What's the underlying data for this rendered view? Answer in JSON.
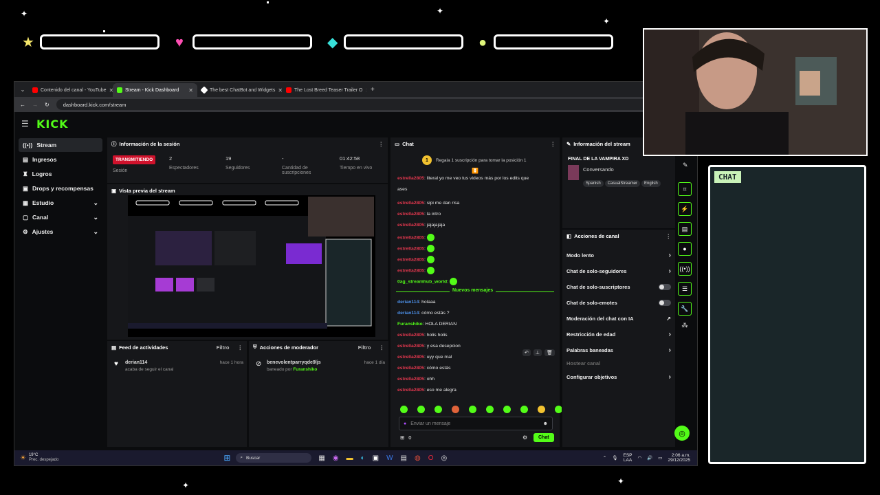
{
  "overlay": {
    "bar_icons": [
      "star-icon",
      "heart-icon",
      "diamond-icon",
      "coin-icon"
    ],
    "chat_box_label": "CHAT"
  },
  "browser": {
    "tabs": [
      {
        "label": "Contenido del canal - YouTube",
        "color": "#ff0000"
      },
      {
        "label": "Stream - Kick Dashboard",
        "color": "#53fc18"
      },
      {
        "label": "The best ChatBot and Widgets",
        "color": "#ffffff"
      },
      {
        "label": "The Lost Breed Teaser Trailer O",
        "color": "#ff0000"
      }
    ],
    "url": "dashboard.kick.com/stream"
  },
  "app": {
    "logo": "KICK",
    "sidebar": [
      {
        "label": "Stream",
        "icon": "stream-icon",
        "active": true
      },
      {
        "label": "Ingresos",
        "icon": "money-icon"
      },
      {
        "label": "Logros",
        "icon": "trophy-icon"
      },
      {
        "label": "Drops y recompensas",
        "icon": "gift-icon"
      },
      {
        "label": "Estudio",
        "icon": "studio-icon",
        "chevron": true
      },
      {
        "label": "Canal",
        "icon": "channel-icon",
        "chevron": true
      },
      {
        "label": "Ajustes",
        "icon": "settings-icon",
        "chevron": true
      }
    ],
    "session": {
      "title": "Información de la sesión",
      "status": "TRANSMITIENDO",
      "status_label": "Sesión",
      "viewers": "2",
      "viewers_label": "Espectadores",
      "followers": "19",
      "followers_label": "Seguidores",
      "subs": "-",
      "subs_label": "Cantidad de suscripciones",
      "time": "01:42:58",
      "time_label": "Tiempo en vivo"
    },
    "preview_title": "Vista previa del stream",
    "activity": {
      "title": "Feed de actividades",
      "filter": "Filtro",
      "user": "derian114",
      "time": "hace 1 hora",
      "text": "acaba de seguir el canal"
    },
    "moderator": {
      "title": "Acciones de moderador",
      "filter": "Filtro",
      "user": "benevolentparryqde9ljs",
      "time": "hace 1 día",
      "text_prefix": "baneado por",
      "by": "Furanshiko"
    },
    "chat": {
      "title": "Chat",
      "promo": "Regala 1 suscripción para tomar la posición 1",
      "promo_number": "1",
      "new_messages": "Nuevos mensajes",
      "placeholder": "Enviar un mensaje",
      "count": "0",
      "send": "Chat",
      "messages": [
        {
          "user": "estrella2805",
          "color": "#e3374e",
          "text": ": literal yo me veo tus videos más por los edits que"
        },
        {
          "user": "",
          "color": "#e6e6e6",
          "text": "ases"
        },
        {
          "user": "estrella2805",
          "color": "#e3374e",
          "text": ": sipi me dan risa"
        },
        {
          "user": "estrella2805",
          "color": "#e3374e",
          "text": ": la intro"
        },
        {
          "user": "estrella2805",
          "color": "#e3374e",
          "text": ": jajajajaja"
        },
        {
          "user": "estrella2805",
          "color": "#e3374e",
          "text": ":",
          "emote": true
        },
        {
          "user": "estrella2805",
          "color": "#e3374e",
          "text": ":",
          "emote": true
        },
        {
          "user": "estrella2805",
          "color": "#e3374e",
          "text": ":",
          "emote": true
        },
        {
          "user": "estrella2805",
          "color": "#e3374e",
          "text": ":",
          "emote": true
        },
        {
          "user": "0ag_streamhub_world",
          "color": "#53fc18",
          "text": ":",
          "emote": true
        },
        {
          "user": "derian114",
          "color": "#4c8fe8",
          "text": ": holaaa"
        },
        {
          "user": "derian114",
          "color": "#4c8fe8",
          "text": ": cómo estás ?"
        },
        {
          "user": "Furanshiko",
          "color": "#53fc18",
          "text": ": HOLA DERIAN"
        },
        {
          "user": "estrella2805",
          "color": "#e3374e",
          "text": ": holis holis"
        },
        {
          "user": "estrella2805",
          "color": "#e3374e",
          "text": ": y esa desepcion"
        },
        {
          "user": "estrella2805",
          "color": "#e3374e",
          "text": ": uyy que mal"
        },
        {
          "user": "estrella2805",
          "color": "#e3374e",
          "text": ": cómo estás"
        },
        {
          "user": "estrella2805",
          "color": "#e3374e",
          "text": ": ohh"
        },
        {
          "user": "estrella2805",
          "color": "#e3374e",
          "text": ": eso me alegra"
        }
      ]
    },
    "stream_info": {
      "title": "Información del stream",
      "stream_title": "FINAL DE LA VAMPIRA XD",
      "category": "Conversando",
      "tags": [
        "Spanish",
        "CasualStreamer",
        "English"
      ]
    },
    "channel_actions": {
      "title": "Acciones de canal",
      "items": [
        {
          "label": "Modo lento",
          "type": "chevron"
        },
        {
          "label": "Chat de solo-seguidores",
          "type": "chevron"
        },
        {
          "label": "Chat de solo-suscriptores",
          "type": "toggle"
        },
        {
          "label": "Chat de solo-emotes",
          "type": "toggle"
        },
        {
          "label": "Moderación del chat con IA",
          "type": "link"
        },
        {
          "label": "Restricción de edad",
          "type": "chevron"
        },
        {
          "label": "Palabras baneadas",
          "type": "chevron"
        },
        {
          "label": "Hostear canal",
          "type": "disabled"
        },
        {
          "label": "Configurar objetivos",
          "type": "chevron"
        }
      ]
    }
  },
  "taskbar": {
    "weather_temp": "19°C",
    "weather_desc": "Prec. despejado",
    "search": "Buscar",
    "lang": "ESP",
    "lang2": "LAA",
    "time": "2:06 a.m.",
    "date": "29/12/2025"
  }
}
